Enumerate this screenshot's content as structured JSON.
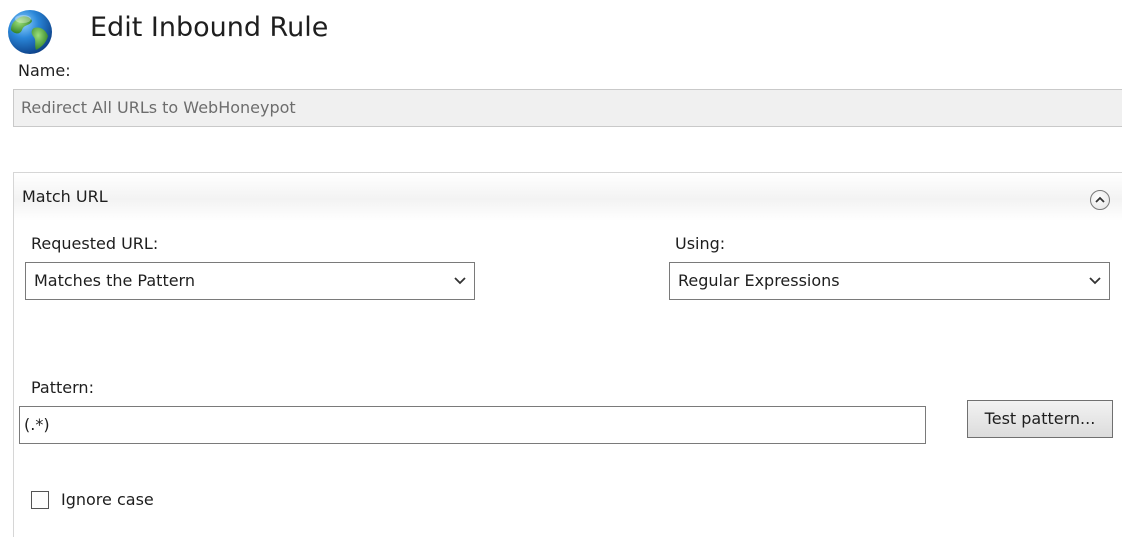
{
  "header": {
    "title": "Edit Inbound Rule",
    "icon": "globe-icon"
  },
  "name": {
    "label": "Name:",
    "value": "Redirect All URLs to WebHoneypot"
  },
  "match_url": {
    "title": "Match URL",
    "collapse_icon": "chevron-up-icon",
    "requested_url": {
      "label": "Requested URL:",
      "selected": "Matches the Pattern"
    },
    "using": {
      "label": "Using:",
      "selected": "Regular Expressions"
    },
    "pattern": {
      "label": "Pattern:",
      "value": "(.*)"
    },
    "test_pattern_label": "Test pattern...",
    "ignore_case": {
      "label": "Ignore case",
      "checked": false
    }
  },
  "colors": {
    "readonly_field_bg": "#f0f0f0",
    "globe_blue": "#1f6fc4",
    "globe_green": "#3b9a2e"
  }
}
